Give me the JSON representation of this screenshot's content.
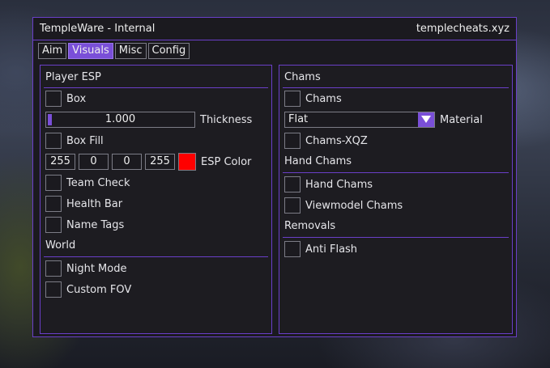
{
  "window": {
    "title": "TempleWare - Internal",
    "site": "templecheats.xyz",
    "accent_color": "#7a4fd8"
  },
  "tabs": [
    {
      "label": "Aim",
      "active": false
    },
    {
      "label": "Visuals",
      "active": true
    },
    {
      "label": "Misc",
      "active": false
    },
    {
      "label": "Config",
      "active": false
    }
  ],
  "left": {
    "player_esp": {
      "title": "Player ESP",
      "box": {
        "label": "Box",
        "checked": false
      },
      "thickness": {
        "label": "Thickness",
        "value": "1.000"
      },
      "box_fill": {
        "label": "Box Fill",
        "checked": false
      },
      "esp_color": {
        "label": "ESP Color",
        "r": "255",
        "g": "0",
        "b": "0",
        "a": "255",
        "swatch": "#ff0000"
      },
      "team_check": {
        "label": "Team Check",
        "checked": false
      },
      "health_bar": {
        "label": "Health Bar",
        "checked": false
      },
      "name_tags": {
        "label": "Name Tags",
        "checked": false
      }
    },
    "world": {
      "title": "World",
      "night_mode": {
        "label": "Night Mode",
        "checked": false
      },
      "custom_fov": {
        "label": "Custom FOV",
        "checked": false
      }
    }
  },
  "right": {
    "chams": {
      "title": "Chams",
      "chams": {
        "label": "Chams",
        "checked": false
      },
      "material": {
        "label": "Material",
        "value": "Flat"
      },
      "chams_xqz": {
        "label": "Chams-XQZ",
        "checked": false
      }
    },
    "hand_chams": {
      "title": "Hand Chams",
      "hand_chams": {
        "label": "Hand Chams",
        "checked": false
      },
      "viewmodel_chams": {
        "label": "Viewmodel Chams",
        "checked": false
      }
    },
    "removals": {
      "title": "Removals",
      "anti_flash": {
        "label": "Anti Flash",
        "checked": false
      }
    }
  }
}
